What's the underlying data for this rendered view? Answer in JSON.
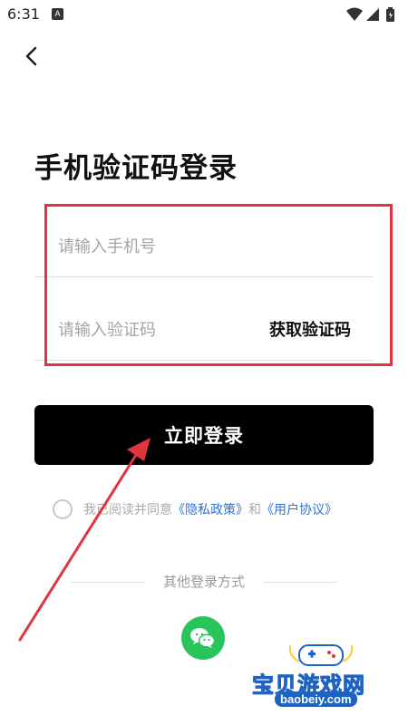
{
  "status_bar": {
    "time": "6:31",
    "notification_badge": "A",
    "icons": [
      "wifi-icon",
      "signal-icon",
      "battery-icon"
    ]
  },
  "nav": {
    "back_icon": "chevron-left-icon"
  },
  "page": {
    "title": "手机验证码登录"
  },
  "form": {
    "phone": {
      "placeholder": "请输入手机号",
      "value": ""
    },
    "code": {
      "placeholder": "请输入验证码",
      "value": ""
    },
    "get_code_label": "获取验证码",
    "submit_label": "立即登录"
  },
  "agreement": {
    "checked": false,
    "prefix": "我已阅读并同意",
    "privacy_link": "《隐私政策》",
    "conjunction": "和",
    "terms_link": "《用户协议》"
  },
  "other_login": {
    "label": "其他登录方式",
    "methods": [
      "wechat-icon"
    ]
  },
  "watermark": {
    "title": "宝贝游戏网",
    "url": "baobeiy.com"
  },
  "colors": {
    "button": "#000000",
    "link": "#2a73d6",
    "highlight_box": "#e0353d",
    "wechat": "#29c45c"
  }
}
